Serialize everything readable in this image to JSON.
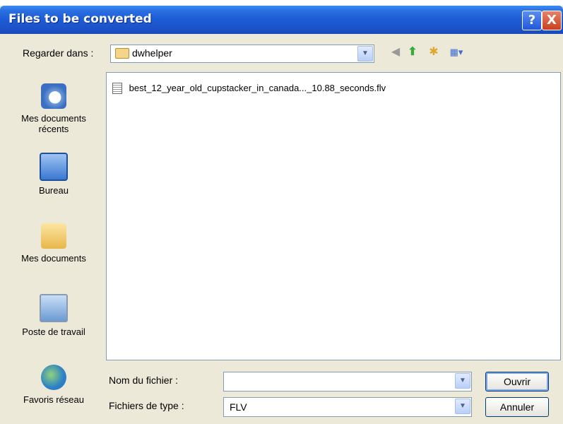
{
  "dialog": {
    "title": "Files to be converted",
    "help_label": "?",
    "close_label": "X"
  },
  "toolbar": {
    "look_in_label": "Regarder dans :",
    "look_in_value": "dwhelper",
    "icons": [
      "back-icon",
      "up-folder-icon",
      "new-folder-icon",
      "views-menu-icon"
    ]
  },
  "places": [
    {
      "label": "Mes documents récents",
      "icon": "recent-documents-icon"
    },
    {
      "label": "Bureau",
      "icon": "desktop-icon"
    },
    {
      "label": "Mes documents",
      "icon": "my-documents-icon"
    },
    {
      "label": "Poste de travail",
      "icon": "my-computer-icon"
    },
    {
      "label": "Favoris réseau",
      "icon": "network-places-icon"
    }
  ],
  "files": [
    {
      "name": "best_12_year_old_cupstacker_in_canada..._10.88_seconds.flv"
    }
  ],
  "filename": {
    "label": "Nom du fichier :",
    "value": ""
  },
  "filetype": {
    "label": "Fichiers de type :",
    "value": "FLV"
  },
  "buttons": {
    "open": "Ouvrir",
    "cancel": "Annuler"
  },
  "colors": {
    "titlebar": "#1d5bd6",
    "dialog_bg": "#ece9d8",
    "close_button": "#c8401c"
  }
}
